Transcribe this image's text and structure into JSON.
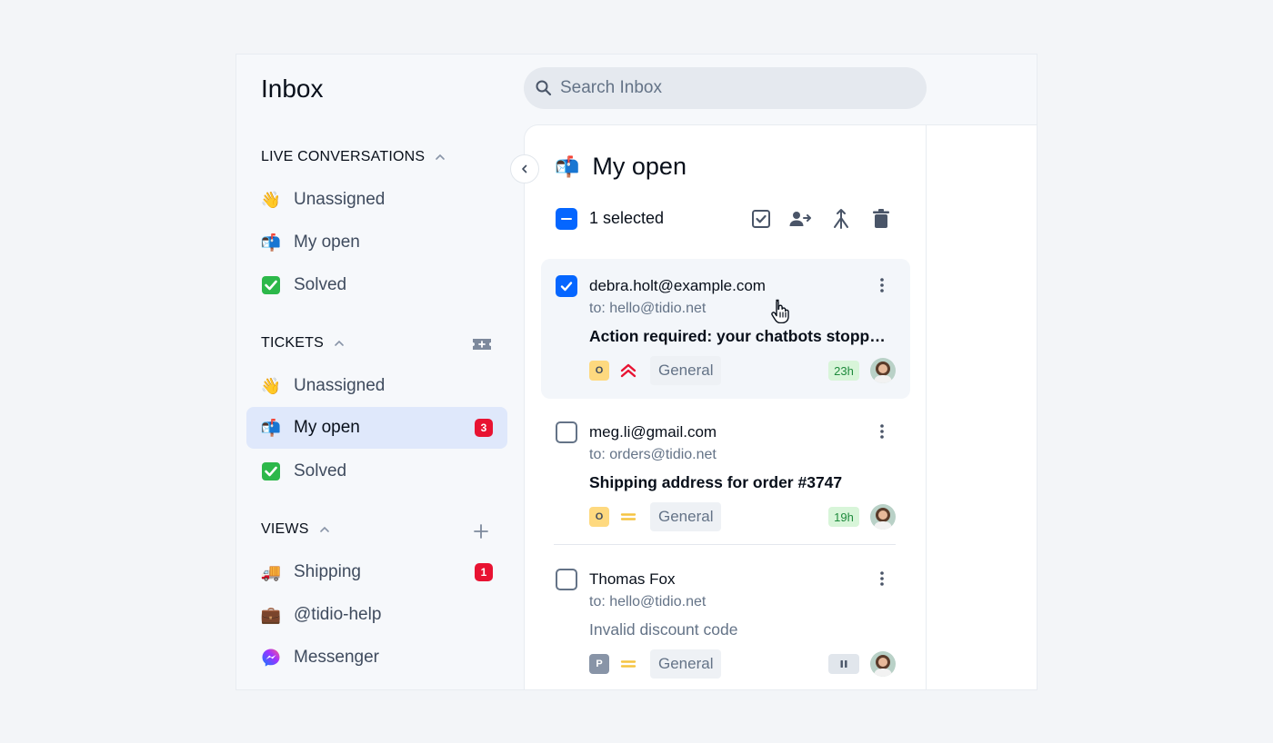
{
  "app": {
    "title": "Inbox"
  },
  "search": {
    "placeholder": "Search Inbox"
  },
  "sidebar": {
    "live": {
      "title": "LIVE CONVERSATIONS",
      "items": [
        {
          "label": "Unassigned",
          "icon": "waving-hand-icon"
        },
        {
          "label": "My open",
          "icon": "mailbox-icon"
        },
        {
          "label": "Solved",
          "icon": "check-mark-icon"
        }
      ]
    },
    "tickets": {
      "title": "TICKETS",
      "items": [
        {
          "label": "Unassigned",
          "icon": "waving-hand-icon"
        },
        {
          "label": "My open",
          "icon": "mailbox-icon",
          "badge": "3",
          "active": true
        },
        {
          "label": "Solved",
          "icon": "check-mark-icon"
        }
      ]
    },
    "views": {
      "title": "VIEWS",
      "items": [
        {
          "label": "Shipping",
          "icon": "truck-icon",
          "badge": "1"
        },
        {
          "label": "@tidio-help",
          "icon": "briefcase-icon"
        },
        {
          "label": "Messenger",
          "icon": "messenger-icon"
        }
      ]
    }
  },
  "list": {
    "title": "My open",
    "selected_text": "1 selected"
  },
  "tickets": [
    {
      "from": "debra.holt@example.com",
      "to": "to: hello@tidio.net",
      "subject": "Action required: your chatbots stopped working",
      "status": "O",
      "priority": "urgent",
      "tag": "General",
      "sla": "23h",
      "checked": true
    },
    {
      "from": "meg.li@gmail.com",
      "to": "to: orders@tidio.net",
      "subject": "Shipping address for order #3747",
      "status": "O",
      "priority": "medium",
      "tag": "General",
      "sla": "19h",
      "checked": false
    },
    {
      "from": "Thomas Fox",
      "to": "to: hello@tidio.net",
      "subject": "Invalid discount code",
      "status": "P",
      "priority": "medium",
      "tag": "General",
      "sla": "paused",
      "checked": false
    }
  ],
  "colors": {
    "accent": "#0566ff",
    "badge": "#e81332",
    "active_bg": "#dfe8fb",
    "urgent": "#e81332",
    "medium": "#f5c441"
  }
}
